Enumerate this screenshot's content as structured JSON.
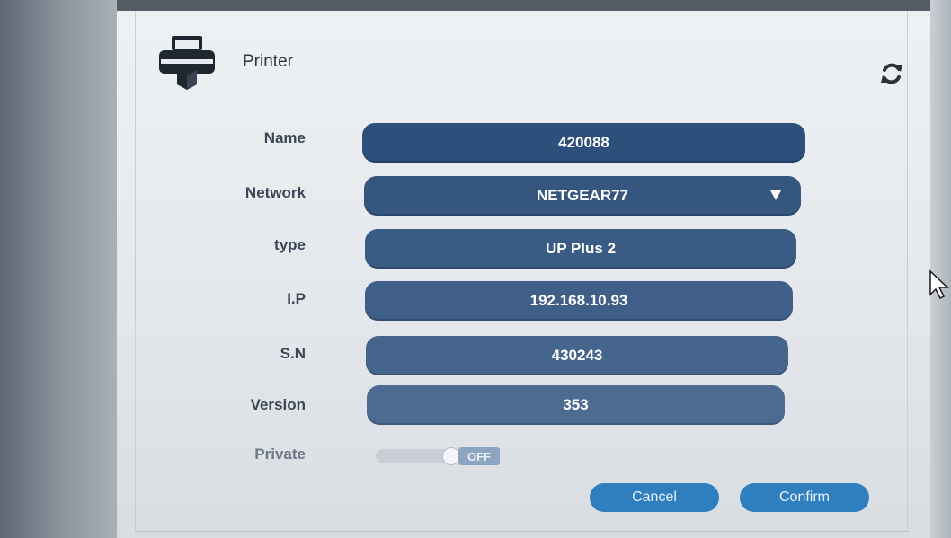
{
  "dialog": {
    "title": "Printer"
  },
  "icons": {
    "printer": "printer-icon",
    "refresh": "refresh-icon",
    "dropdown": "chevron-down-icon",
    "cursor": "mouse-pointer-icon"
  },
  "fields": {
    "name": {
      "label": "Name",
      "value": "420088"
    },
    "network": {
      "label": "Network",
      "value": "NETGEAR77"
    },
    "type": {
      "label": "type",
      "value": "UP Plus 2"
    },
    "ip": {
      "label": "I.P",
      "value": "192.168.10.93"
    },
    "sn": {
      "label": "S.N",
      "value": "430243"
    },
    "version": {
      "label": "Version",
      "value": "353"
    }
  },
  "private": {
    "label": "Private",
    "state": "OFF"
  },
  "buttons": {
    "cancel": "Cancel",
    "confirm": "Confirm"
  },
  "colors": {
    "field": "#2d4f7c",
    "button": "#2f7fbf",
    "label": "#3a4656"
  }
}
